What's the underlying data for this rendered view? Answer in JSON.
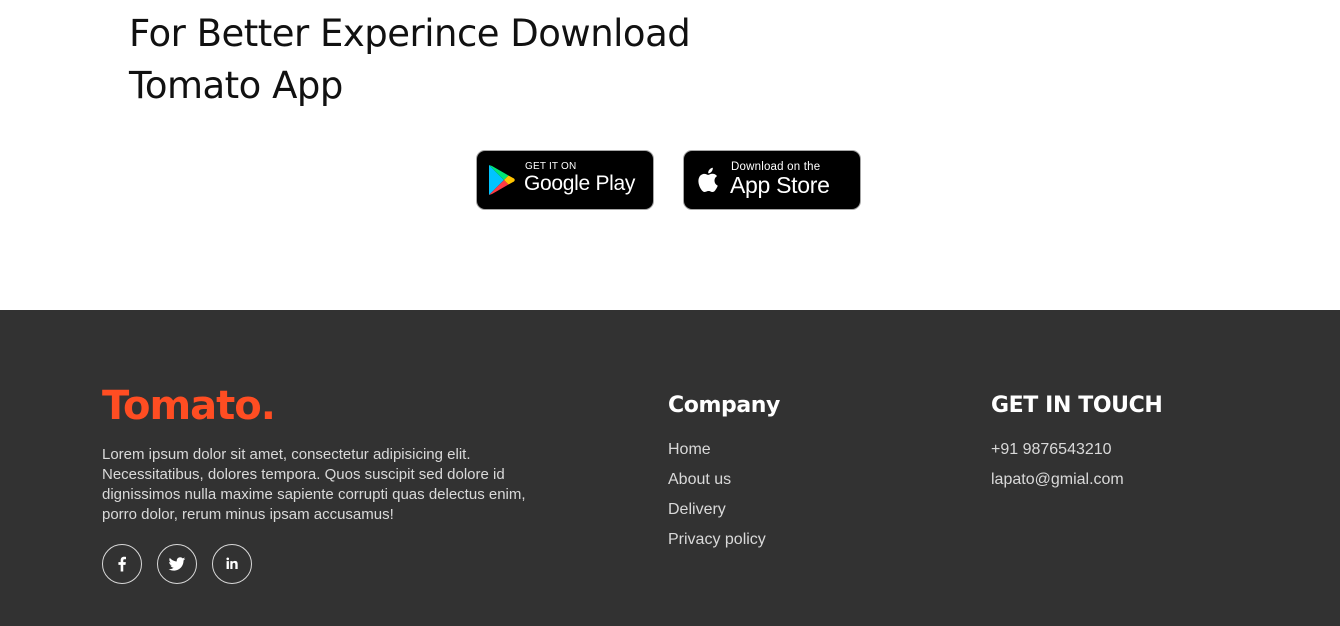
{
  "app_download": {
    "title_line1": "For Better Experince Download",
    "title_line2": "Tomato App",
    "google_play": {
      "small": "GET IT ON",
      "big": "Google Play",
      "icon": "google-play-icon"
    },
    "app_store": {
      "small": "Download on the",
      "big": "App Store",
      "icon": "apple-icon"
    }
  },
  "footer": {
    "brand": "Tomato.",
    "description": "Lorem ipsum dolor sit amet, consectetur adipisicing elit. Necessitatibus, dolores tempora. Quos suscipit sed dolore id dignissimos nulla maxime sapiente corrupti quas delectus enim, porro dolor, rerum minus ipsam accusamus!",
    "social": [
      "facebook-icon",
      "twitter-icon",
      "linkedin-icon"
    ],
    "company": {
      "title": "Company",
      "links": [
        "Home",
        "About us",
        "Delivery",
        "Privacy policy"
      ]
    },
    "contact": {
      "title": "GET IN TOUCH",
      "items": [
        "+91 9876543210",
        "lapato@gmial.com"
      ]
    }
  },
  "colors": {
    "brand": "#ff4d22",
    "footer_bg": "#323232",
    "footer_text": "#d9d9d9"
  }
}
